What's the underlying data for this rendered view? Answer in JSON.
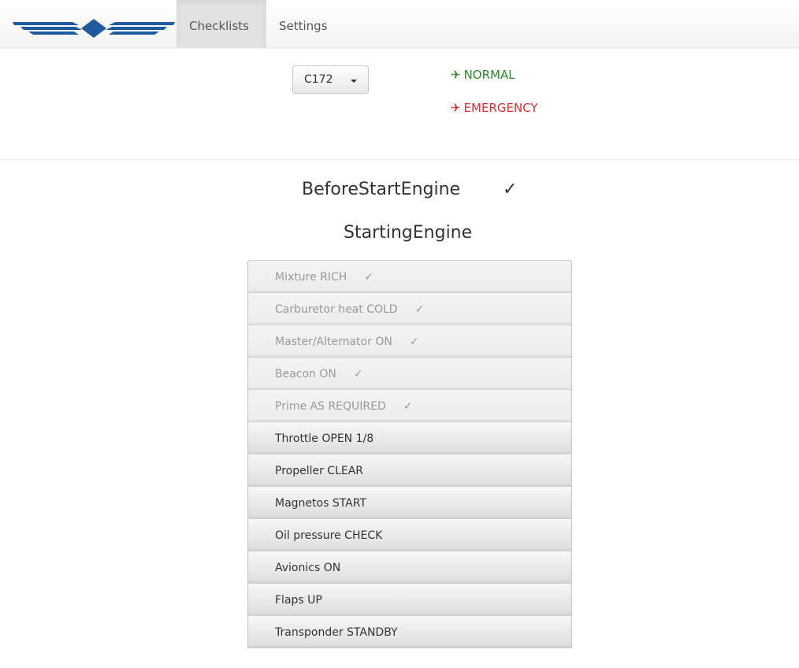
{
  "nav": {
    "logo_icon": "wings-diamond-logo",
    "tabs": [
      {
        "label": "Checklists",
        "active": true
      },
      {
        "label": "Settings",
        "active": false
      }
    ]
  },
  "aircraft_select": {
    "value": "C172",
    "icon": "caret-down-icon"
  },
  "modes": {
    "normal": {
      "icon": "✈",
      "label": "NORMAL",
      "color": "#2b8a2b"
    },
    "emergency": {
      "icon": "✈",
      "label": "EMERGENCY",
      "color": "#e03030"
    }
  },
  "sections": {
    "before_start": {
      "title": "BeforeStartEngine",
      "check": "✓"
    },
    "starting": {
      "title": "StartingEngine"
    }
  },
  "check_mark": "✓",
  "items": [
    {
      "label": "Mixture RICH",
      "done": true
    },
    {
      "label": "Carburetor heat COLD",
      "done": true
    },
    {
      "label": "Master/Alternator ON",
      "done": true
    },
    {
      "label": "Beacon ON",
      "done": true
    },
    {
      "label": "Prime AS REQUIRED",
      "done": true
    },
    {
      "label": "Throttle OPEN 1/8",
      "done": false
    },
    {
      "label": "Propeller CLEAR",
      "done": false
    },
    {
      "label": "Magnetos START",
      "done": false
    },
    {
      "label": "Oil pressure CHECK",
      "done": false
    },
    {
      "label": "Avionics ON",
      "done": false
    },
    {
      "label": "Flaps UP",
      "done": false
    },
    {
      "label": "Transponder STANDBY",
      "done": false
    }
  ]
}
